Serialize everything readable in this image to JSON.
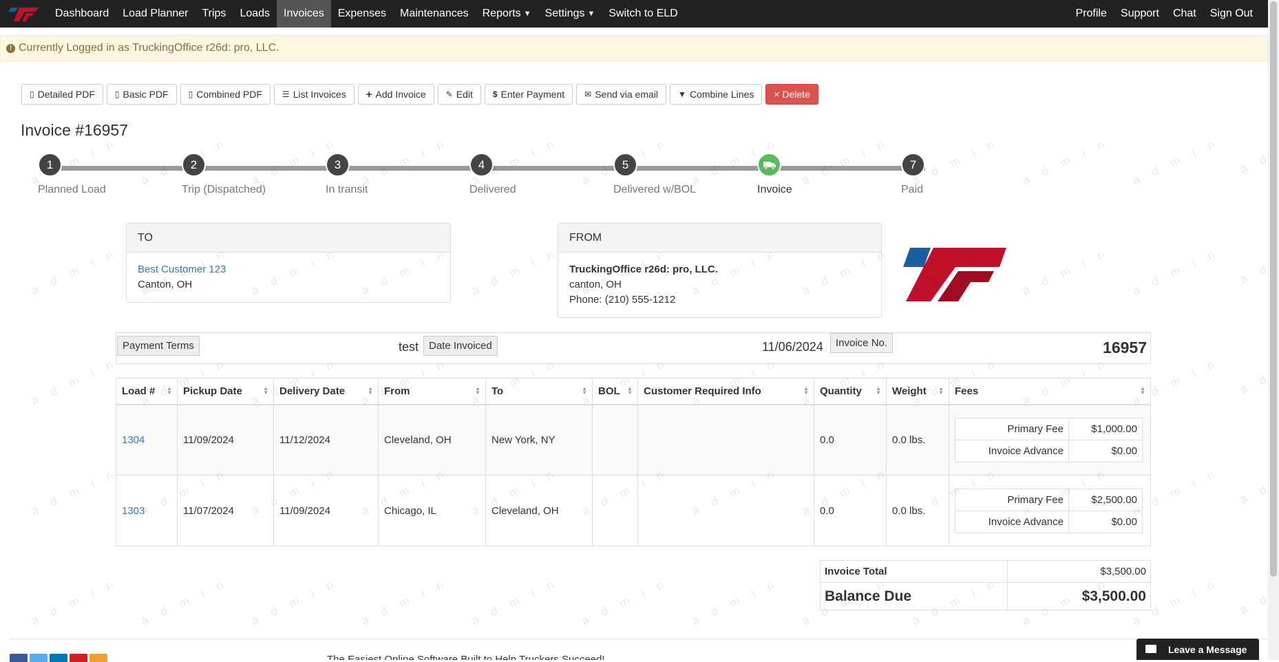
{
  "nav": {
    "left": [
      {
        "label": "Dashboard"
      },
      {
        "label": "Load Planner"
      },
      {
        "label": "Trips"
      },
      {
        "label": "Loads"
      },
      {
        "label": "Invoices"
      },
      {
        "label": "Expenses"
      },
      {
        "label": "Maintenances"
      },
      {
        "label": "Reports"
      },
      {
        "label": "Settings"
      },
      {
        "label": "Switch to ELD"
      }
    ],
    "right": [
      {
        "label": "Profile"
      },
      {
        "label": "Support"
      },
      {
        "label": "Chat"
      },
      {
        "label": "Sign Out"
      }
    ]
  },
  "alert": {
    "text": "Currently Logged in as TruckingOffice r26d: pro, LLC."
  },
  "toolbar": {
    "detailed_pdf": "Detailed PDF",
    "basic_pdf": "Basic PDF",
    "combined_pdf": "Combined PDF",
    "list_invoices": "List Invoices",
    "add_invoice": "Add Invoice",
    "edit": "Edit",
    "enter_payment": "Enter Payment",
    "send_email": "Send via email",
    "combine_lines": "Combine Lines",
    "delete": "× Delete"
  },
  "page_title": "Invoice #16957",
  "steps": [
    {
      "num": "1",
      "label": "Planned Load"
    },
    {
      "num": "2",
      "label": "Trip (Dispatched)"
    },
    {
      "num": "3",
      "label": "In transit"
    },
    {
      "num": "4",
      "label": "Delivered"
    },
    {
      "num": "5",
      "label": "Delivered w/BOL"
    },
    {
      "num": "",
      "label": "Invoice"
    },
    {
      "num": "7",
      "label": "Paid"
    }
  ],
  "to_panel": {
    "heading": "TO",
    "customer": "Best Customer 123",
    "city": "Canton, OH"
  },
  "from_panel": {
    "heading": "FROM",
    "company": "TruckingOffice r26d: pro, LLC.",
    "city": "canton, OH",
    "phone": "Phone: (210) 555-1212"
  },
  "info": {
    "terms_label": "Payment Terms",
    "terms_value": "test",
    "date_label": "Date Invoiced",
    "date_value": "11/06/2024",
    "no_label": "Invoice No.",
    "no_value": "16957"
  },
  "table": {
    "headers": [
      "Load #",
      "Pickup Date",
      "Delivery Date",
      "From",
      "To",
      "BOL",
      "Customer Required Info",
      "Quantity",
      "Weight",
      "Fees"
    ],
    "rows": [
      {
        "load": "1304",
        "pickup": "11/09/2024",
        "delivery": "11/12/2024",
        "from": "Cleveland, OH",
        "to": "New York, NY",
        "bol": "",
        "cri": "",
        "qty": "0.0",
        "weight": "0.0 lbs.",
        "fee1_label": "Primary Fee",
        "fee1": "$1,000.00",
        "fee2_label": "Invoice Advance",
        "fee2": "$0.00"
      },
      {
        "load": "1303",
        "pickup": "11/07/2024",
        "delivery": "11/09/2024",
        "from": "Chicago, IL",
        "to": "Cleveland, OH",
        "bol": "",
        "cri": "",
        "qty": "0.0",
        "weight": "0.0 lbs.",
        "fee1_label": "Primary Fee",
        "fee1": "$2,500.00",
        "fee2_label": "Invoice Advance",
        "fee2": "$0.00"
      }
    ]
  },
  "totals": {
    "total_label": "Invoice Total",
    "total": "$3,500.00",
    "balance_label": "Balance Due",
    "balance": "$3,500.00"
  },
  "footer": {
    "tagline": "The Easiest Online Software Built to Help Truckers Succeed!",
    "chat_label": "Leave a Message"
  },
  "watermark": "a d m i n",
  "colors": {
    "nav_bg": "#222222",
    "active_nav": "#555555",
    "link": "#337ab7",
    "danger": "#d9534f",
    "success": "#5cb85c",
    "brand_red": "#c0102a",
    "brand_blue": "#1a5f9e"
  }
}
